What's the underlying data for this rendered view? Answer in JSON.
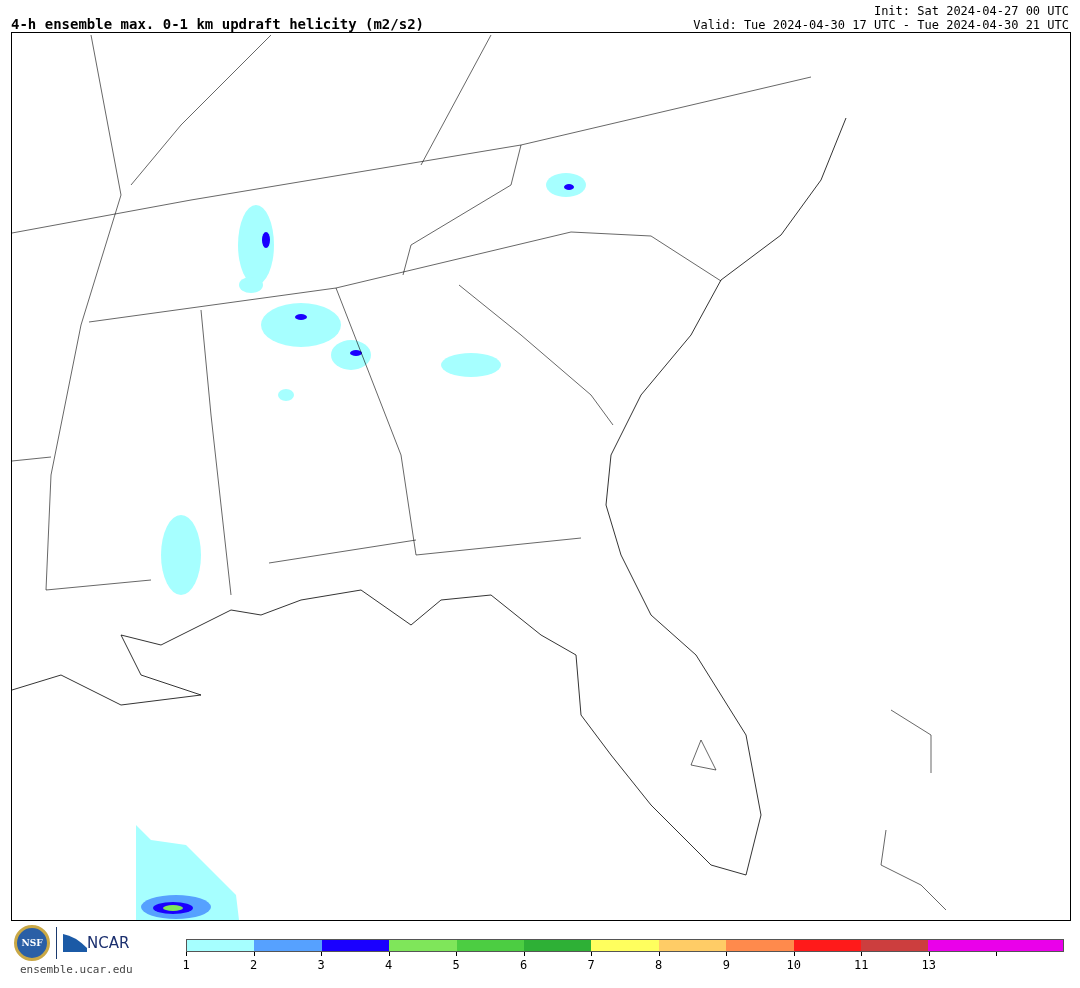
{
  "title": "4-h ensemble max. 0-1 km updraft helicity (m2/s2)",
  "init": "Init: Sat 2024-04-27 00 UTC",
  "valid": "Valid: Tue 2024-04-30 17 UTC - Tue 2024-04-30 21 UTC",
  "logos": {
    "nsf": "NSF",
    "ncar": "NCAR",
    "website": "ensemble.ucar.edu"
  },
  "legend": {
    "segments": [
      {
        "color": "#a6ffff"
      },
      {
        "color": "#56a1ff"
      },
      {
        "color": "#1a00ff"
      },
      {
        "color": "#7fe65a"
      },
      {
        "color": "#4ccd42"
      },
      {
        "color": "#2eb036"
      },
      {
        "color": "#ffff5e"
      },
      {
        "color": "#ffcc66"
      },
      {
        "color": "#ff8a4c"
      },
      {
        "color": "#ff1a1a"
      },
      {
        "color": "#cc3e3e"
      },
      {
        "color": "#ea00ea"
      },
      {
        "color": "#ea00ea"
      }
    ],
    "ticks": [
      "1",
      "2",
      "3",
      "4",
      "5",
      "6",
      "7",
      "8",
      "9",
      "10",
      "11",
      "13"
    ]
  }
}
